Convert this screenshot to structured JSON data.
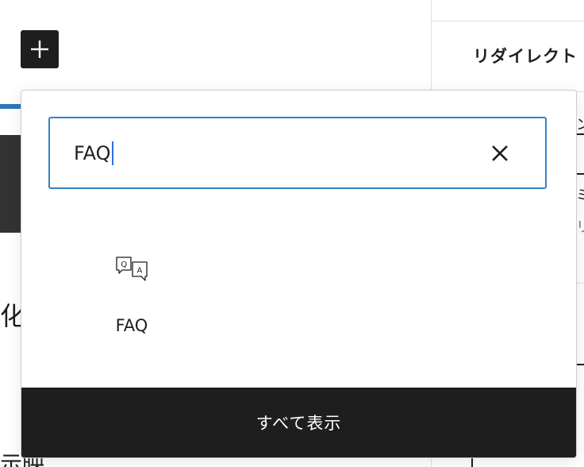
{
  "editor": {
    "add_block_icon": "plus-icon",
    "bg_text_1": "化",
    "bg_text_2": "示映"
  },
  "sidebar": {
    "panel_title": "リダイレクト",
    "fragments": [
      "ン",
      "ミ",
      "リ"
    ]
  },
  "inserter": {
    "search": {
      "value": "FAQ",
      "clear_icon": "close-icon"
    },
    "results": [
      {
        "label": "FAQ",
        "icon": "faq-icon"
      }
    ],
    "browse_all_label": "すべて表示"
  },
  "colors": {
    "accent": "#3581c4",
    "caret": "#2c6fe0",
    "dark": "#1e1e1e"
  }
}
